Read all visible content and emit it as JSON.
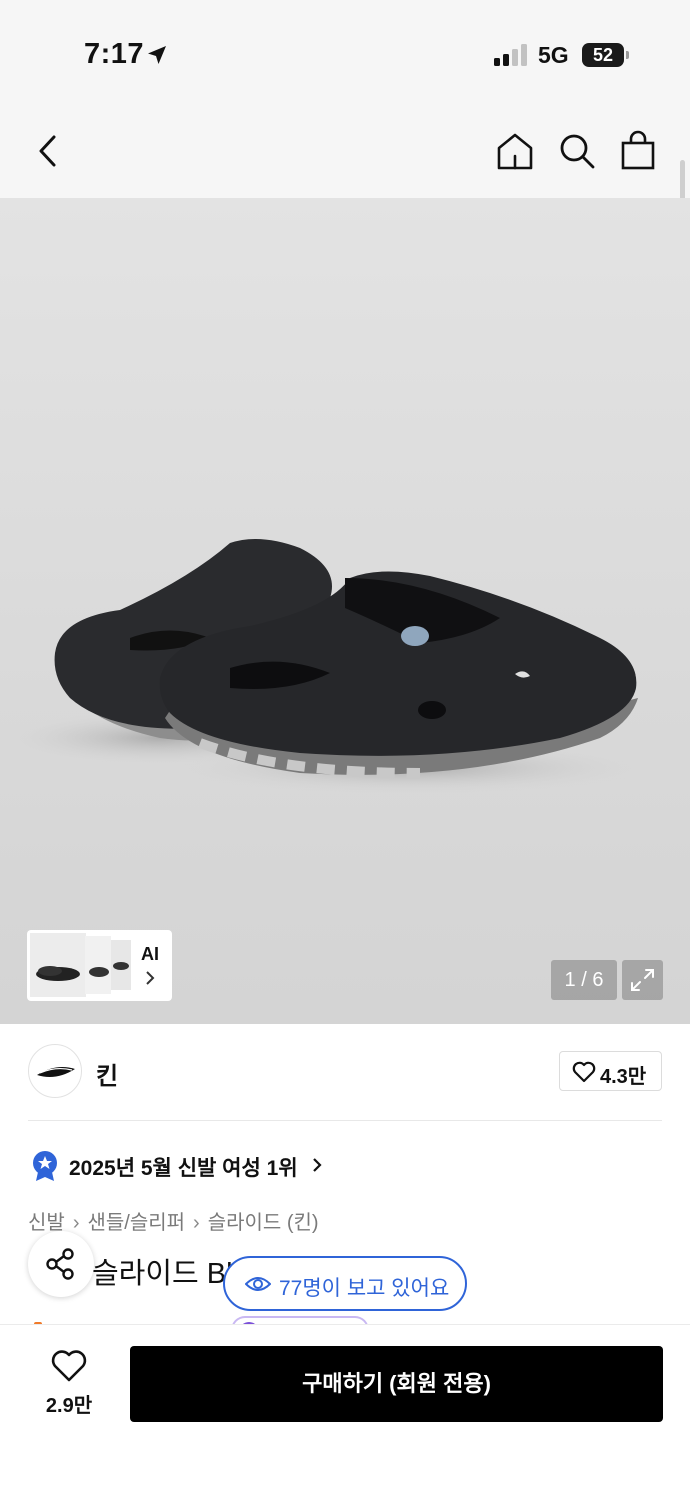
{
  "status_bar": {
    "time": "7:17",
    "network": "5G",
    "battery": "52"
  },
  "nav": {
    "icons": [
      "back-icon",
      "home-icon",
      "search-icon",
      "shopping-bag-icon"
    ]
  },
  "gallery": {
    "ai_label": "AI",
    "counter": "1 / 6"
  },
  "brand": {
    "name": "킨",
    "like_count": "4.3만"
  },
  "ranking": {
    "text": "2025년 5월 신발 여성 1위"
  },
  "breadcrumb": [
    "신발",
    "샌들/슬리퍼",
    "슬라이드 (킨)"
  ],
  "product": {
    "title_visible": "슬라이드 Bl",
    "viewers": "77명이 보고 있어요"
  },
  "bottom": {
    "wish_count": "2.9만",
    "buy_label": "구매하기 (회원 전용)"
  },
  "colors": {
    "accent_blue": "#2f64d8",
    "buy_button": "#000000",
    "header_bg": "#f6f6f6"
  }
}
